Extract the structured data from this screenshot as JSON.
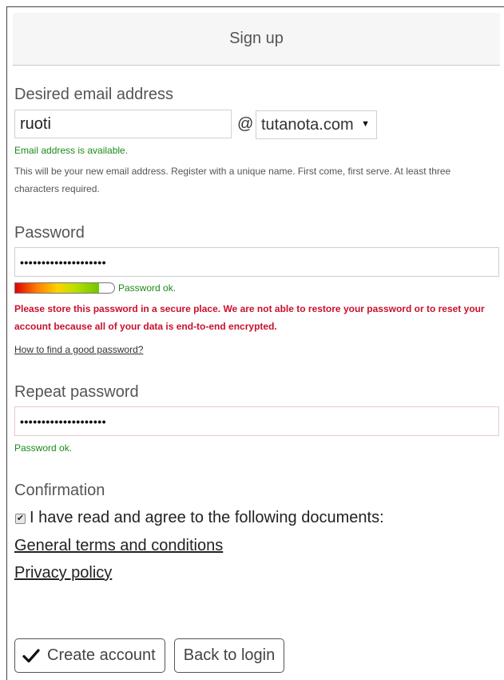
{
  "header": {
    "title": "Sign up"
  },
  "email": {
    "label": "Desired email address",
    "value": "ruoti",
    "at": "@",
    "domain": "tutanota.com",
    "status": "Email address is available.",
    "help": "This will be your new email address. Register with a unique name. First come, first serve. At least three characters required."
  },
  "password": {
    "label": "Password",
    "dots": "••••••••••••••••••••",
    "strength_fraction": 0.85,
    "strength_text": "Password ok.",
    "warning": "Please store this password in a secure place. We are not able to restore your password or to reset your account because all of your data is end-to-end encrypted.",
    "help_link": "How to find a good password?"
  },
  "repeat": {
    "label": "Repeat password",
    "dots": "••••••••••••••••••••",
    "status": "Password ok."
  },
  "confirmation": {
    "label": "Confirmation",
    "checked": true,
    "agree_text": "I have read and agree to the following documents:",
    "terms_link": "General terms and conditions",
    "privacy_link": "Privacy policy"
  },
  "buttons": {
    "create": "Create account",
    "back": "Back to login"
  },
  "colors": {
    "success": "#1b8a1b",
    "error": "#c8102e",
    "header_bg": "#f6f6f6"
  },
  "icons": {
    "check": "check-icon",
    "dropdown": "caret-down-icon",
    "checkbox": "checkbox-checked-icon"
  }
}
